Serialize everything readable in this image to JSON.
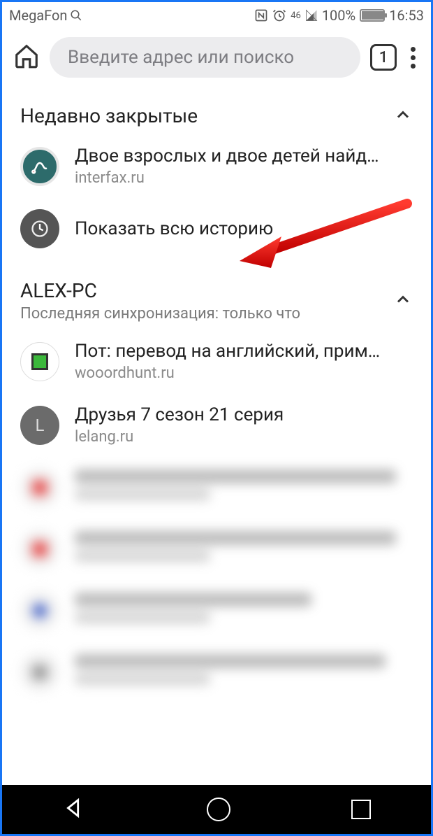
{
  "statusbar": {
    "carrier": "MegaFon",
    "battery_percent": "100%",
    "time": "16:53",
    "network_label": "46"
  },
  "toolbar": {
    "address_placeholder": "Введите адрес или поиско",
    "tab_count": "1"
  },
  "sections": {
    "recent": {
      "title": "Недавно закрытые",
      "items": [
        {
          "title": "Двое взрослых и двое детей найд…",
          "domain": "interfax.ru"
        }
      ],
      "show_all_label": "Показать всю историю"
    },
    "synced": {
      "title": "ALEX-PC",
      "subtitle": "Последняя синхронизация: только что",
      "items": [
        {
          "title": "Пот: перевод на английский, прим…",
          "domain": "wooordhunt.ru"
        },
        {
          "title": "Друзья 7 сезон 21 серия",
          "domain": "lelang.ru"
        }
      ]
    }
  }
}
